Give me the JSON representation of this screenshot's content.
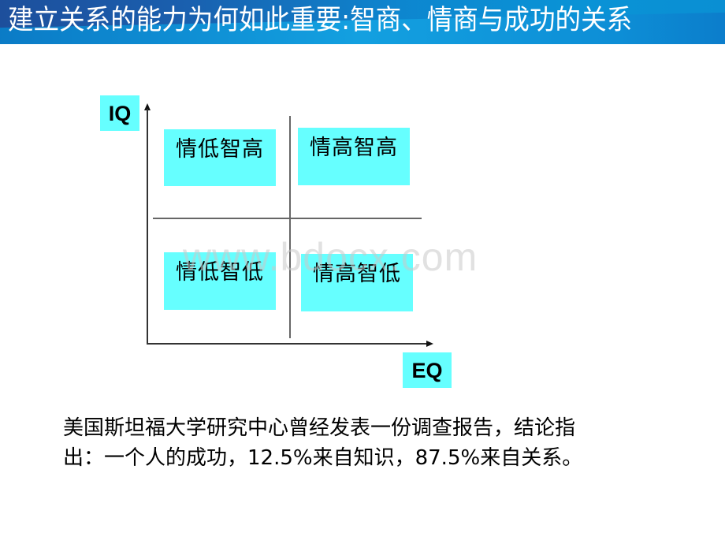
{
  "slide": {
    "title": "建立关系的能力为何如此重要:智商、情商与成功的关系",
    "colors": {
      "header_dark": "#1d4f9c",
      "header_light": "#0a93d6",
      "quadrant_fill": "#66ffff",
      "axis": "#333333",
      "title_text": "#ffffff",
      "body_text": "#000000"
    }
  },
  "diagram": {
    "y_axis_label": "IQ",
    "x_axis_label": "EQ",
    "quadrants": {
      "top_left": "情低智高",
      "top_right": "情高智高",
      "bottom_left": "情低智低",
      "bottom_right": "情高智低"
    }
  },
  "body": {
    "lines": [
      "美国斯坦福大学研究中心曾经发表一份调查报告，结论指",
      "出：一个人的成功，12.5%来自知识，87.5%来自关系。"
    ]
  },
  "watermark": "www.bdocx.com"
}
